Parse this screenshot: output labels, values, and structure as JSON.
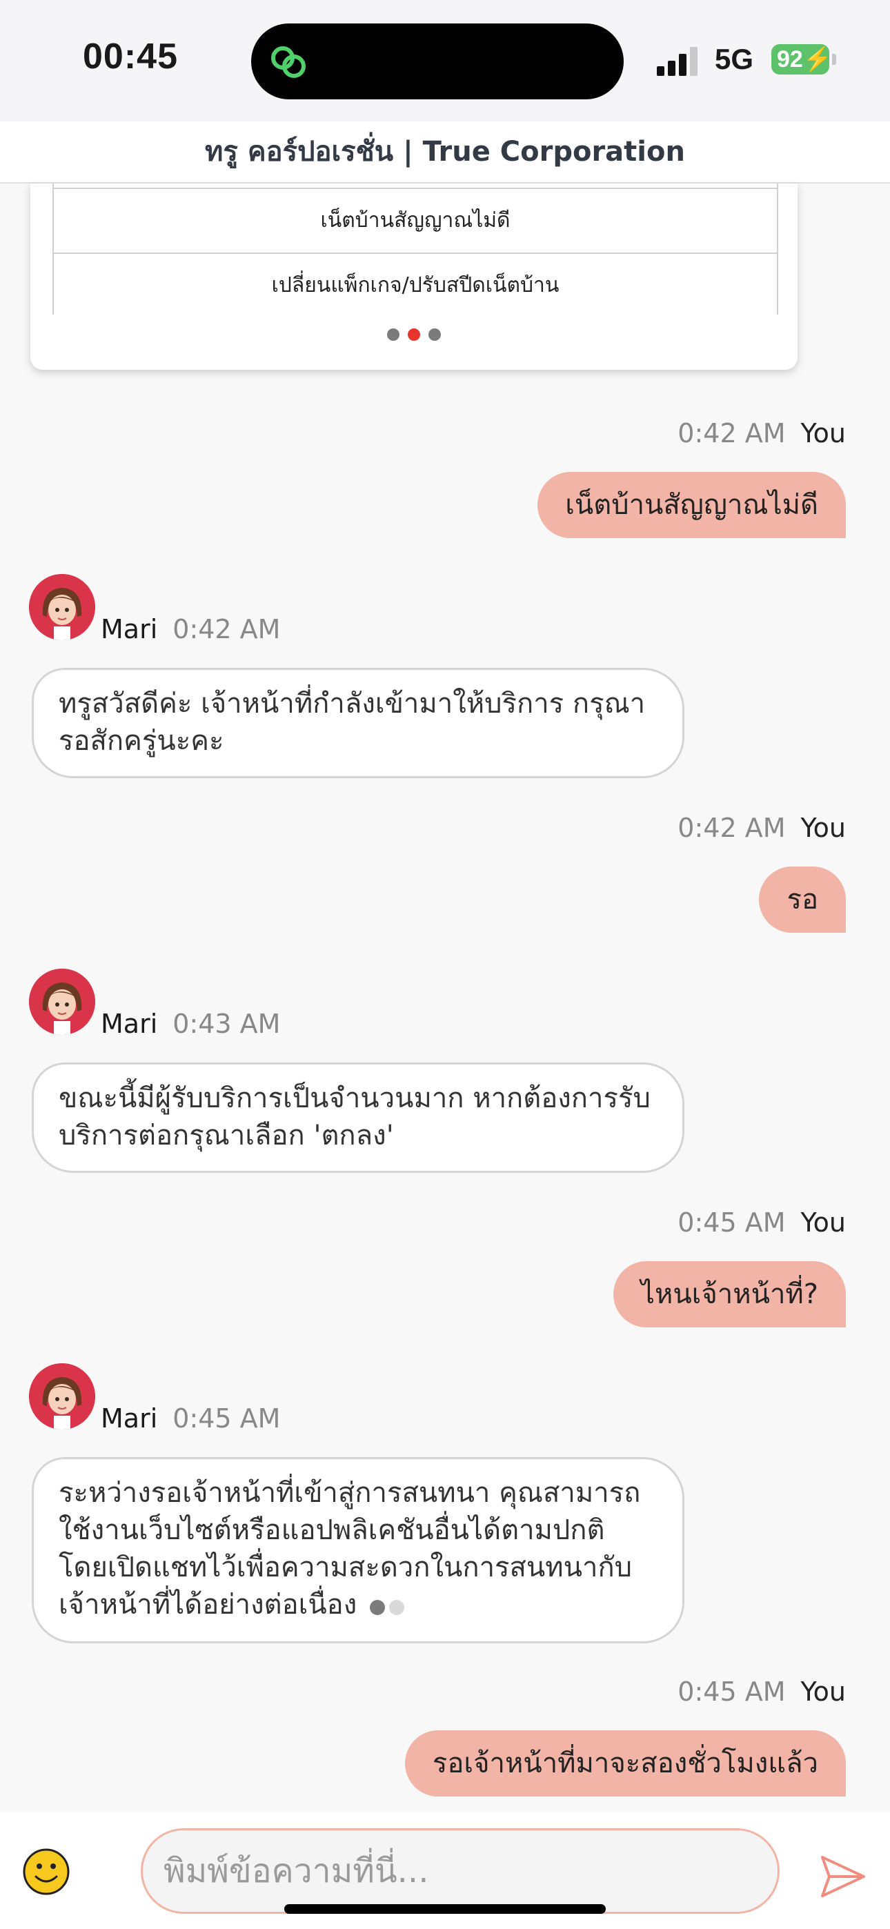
{
  "status_bar": {
    "time": "00:45",
    "network": "5G",
    "battery": "92"
  },
  "header": {
    "title": "ทรู คอร์ปอเรชั่น | True Corporation"
  },
  "menu_card": {
    "items": [
      "เน็ตบ้านสัญญาณไม่ดี",
      "เปลี่ยนแพ็กเกจ/ปรับสปีดเน็ตบ้าน"
    ],
    "pages": 3,
    "active_page": 2
  },
  "messages": [
    {
      "sender": "You",
      "time": "0:42 AM",
      "text": "เน็ตบ้านสัญญาณไม่ดี"
    },
    {
      "sender": "Mari",
      "time": "0:42 AM",
      "text": "ทรูสวัสดีค่ะ เจ้าหน้าที่กำลังเข้ามาให้บริการ กรุณารอสักครู่นะคะ"
    },
    {
      "sender": "You",
      "time": "0:42 AM",
      "text": "รอ"
    },
    {
      "sender": "Mari",
      "time": "0:43 AM",
      "text": "ขณะนี้มีผู้รับบริการเป็นจำนวนมาก หากต้องการรับบริการต่อกรุณาเลือก 'ตกลง'"
    },
    {
      "sender": "You",
      "time": "0:45 AM",
      "text": "ไหนเจ้าหน้าที่?"
    },
    {
      "sender": "Mari",
      "time": "0:45 AM",
      "text": "ระหว่างรอเจ้าหน้าที่เข้าสู่การสนทนา คุณสามารถใช้งานเว็บไซต์หรือแอปพลิเคชันอื่นได้ตามปกติ โดยเปิดแชทไว้เพื่อความสะดวกในการสนทนากับเจ้าหน้าที่ได้อย่างต่อเนื่อง"
    },
    {
      "sender": "You",
      "time": "0:45 AM",
      "text": "รอเจ้าหน้าที่มาจะสองชั่วโมงแล้ว"
    }
  ],
  "composer": {
    "placeholder": "พิมพ์ข้อความที่นี่..."
  },
  "colors": {
    "user_bubble": "#f2b4a6",
    "accent": "#e8362c",
    "battery": "#5ec26a"
  }
}
